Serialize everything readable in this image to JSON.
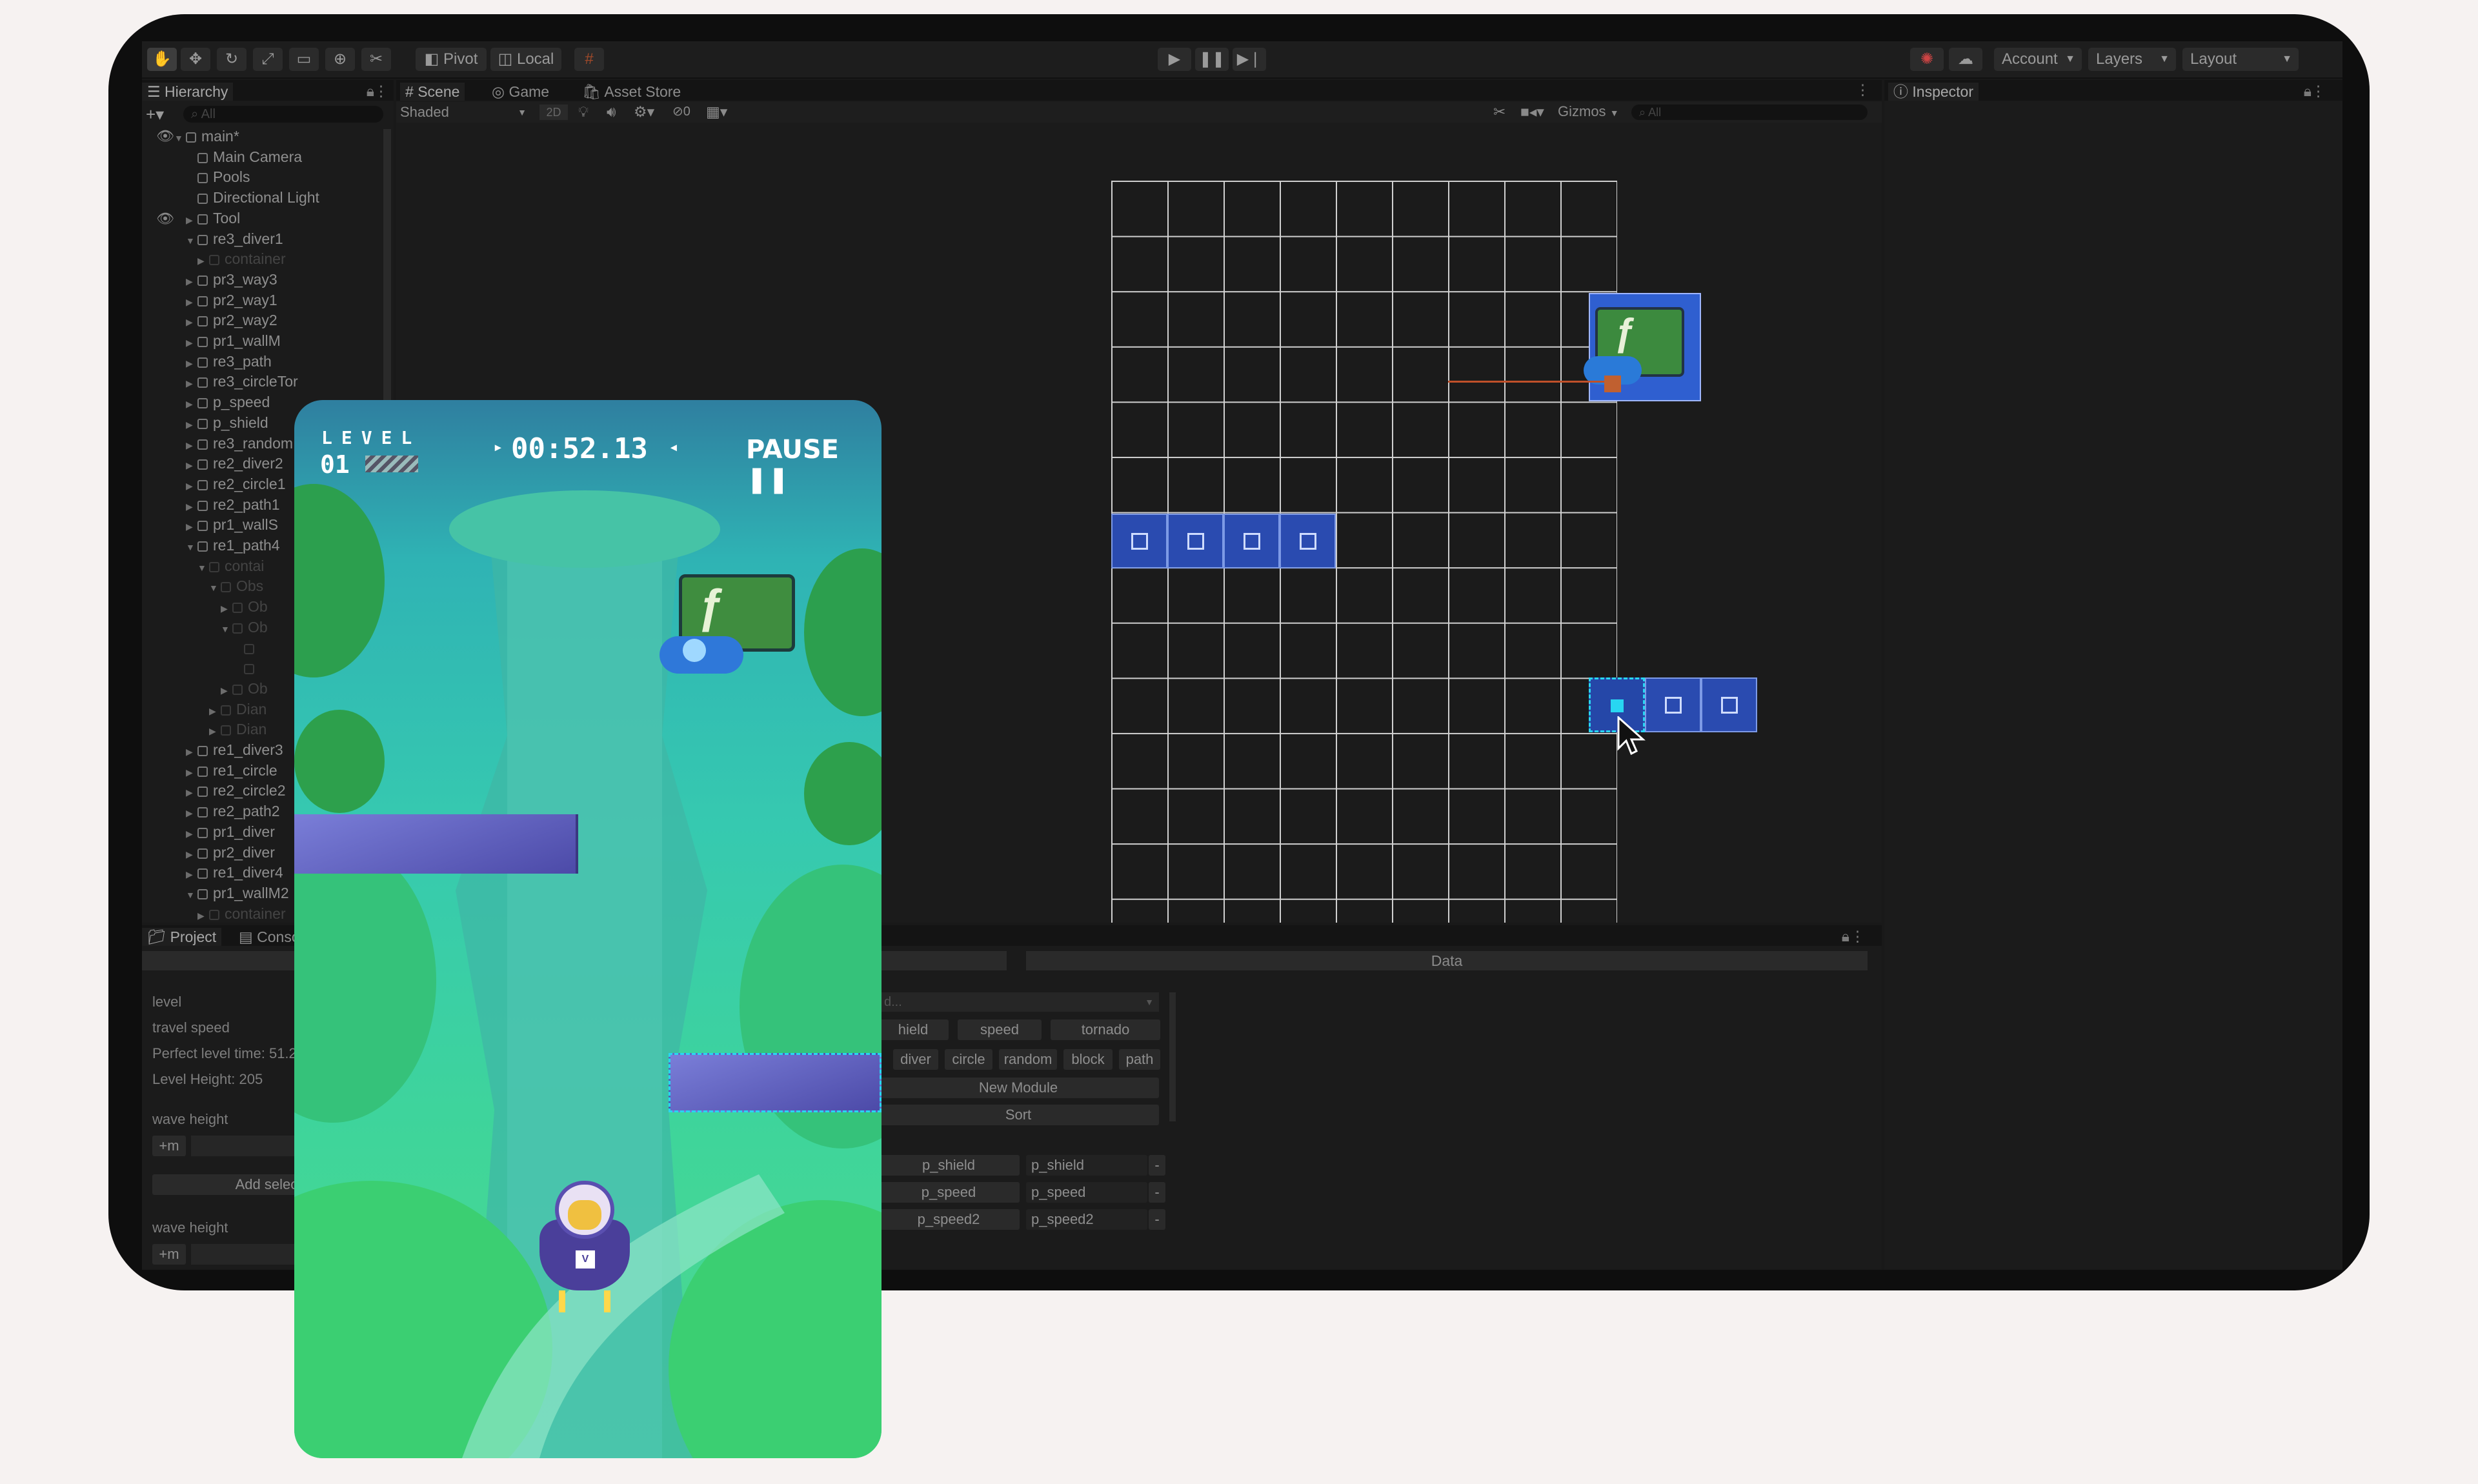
{
  "toolbar": {
    "pivot": "Pivot",
    "local": "Local",
    "account": "Account",
    "layers": "Layers",
    "layout": "Layout"
  },
  "hierarchy": {
    "tab": "Hierarchy",
    "search_placeholder": "All",
    "items": [
      {
        "label": "main*",
        "depth": 0,
        "arrow": "▼"
      },
      {
        "label": "Main Camera",
        "depth": 1,
        "arrow": ""
      },
      {
        "label": "Pools",
        "depth": 1,
        "arrow": ""
      },
      {
        "label": "Directional Light",
        "depth": 1,
        "arrow": ""
      },
      {
        "label": "Tool",
        "depth": 1,
        "arrow": "▶"
      },
      {
        "label": "re3_diver1",
        "depth": 1,
        "arrow": "▼"
      },
      {
        "label": "container",
        "depth": 2,
        "arrow": "▶",
        "dim": true
      },
      {
        "label": "pr3_way3",
        "depth": 1,
        "arrow": "▶"
      },
      {
        "label": "pr2_way1",
        "depth": 1,
        "arrow": "▶"
      },
      {
        "label": "pr2_way2",
        "depth": 1,
        "arrow": "▶"
      },
      {
        "label": "pr1_wallM",
        "depth": 1,
        "arrow": "▶"
      },
      {
        "label": "re3_path",
        "depth": 1,
        "arrow": "▶"
      },
      {
        "label": "re3_circleTor",
        "depth": 1,
        "arrow": "▶"
      },
      {
        "label": "p_speed",
        "depth": 1,
        "arrow": "▶"
      },
      {
        "label": "p_shield",
        "depth": 1,
        "arrow": "▶"
      },
      {
        "label": "re3_random",
        "depth": 1,
        "arrow": "▶"
      },
      {
        "label": "re2_diver2",
        "depth": 1,
        "arrow": "▶"
      },
      {
        "label": "re2_circle1",
        "depth": 1,
        "arrow": "▶"
      },
      {
        "label": "re2_path1",
        "depth": 1,
        "arrow": "▶"
      },
      {
        "label": "pr1_wallS",
        "depth": 1,
        "arrow": "▶"
      },
      {
        "label": "re1_path4",
        "depth": 1,
        "arrow": "▼"
      },
      {
        "label": "contai",
        "depth": 2,
        "arrow": "▼",
        "dim": true
      },
      {
        "label": "Obs",
        "depth": 3,
        "arrow": "▼",
        "dim": true
      },
      {
        "label": "Ob",
        "depth": 4,
        "arrow": "▶",
        "dim": true
      },
      {
        "label": "Ob",
        "depth": 4,
        "arrow": "▼",
        "dim": true
      },
      {
        "label": "",
        "depth": 5,
        "arrow": "",
        "dim": true
      },
      {
        "label": "",
        "depth": 5,
        "arrow": "",
        "dim": true
      },
      {
        "label": "Ob",
        "depth": 4,
        "arrow": "▶",
        "dim": true
      },
      {
        "label": "Dian",
        "depth": 3,
        "arrow": "▶",
        "dim": true
      },
      {
        "label": "Dian",
        "depth": 3,
        "arrow": "▶",
        "dim": true
      },
      {
        "label": "re1_diver3",
        "depth": 1,
        "arrow": "▶"
      },
      {
        "label": "re1_circle",
        "depth": 1,
        "arrow": "▶"
      },
      {
        "label": "re2_circle2",
        "depth": 1,
        "arrow": "▶"
      },
      {
        "label": "re2_path2",
        "depth": 1,
        "arrow": "▶"
      },
      {
        "label": "pr1_diver",
        "depth": 1,
        "arrow": "▶"
      },
      {
        "label": "pr2_diver",
        "depth": 1,
        "arrow": "▶"
      },
      {
        "label": "re1_diver4",
        "depth": 1,
        "arrow": "▶"
      },
      {
        "label": "pr1_wallM2",
        "depth": 1,
        "arrow": "▼"
      },
      {
        "label": "container",
        "depth": 2,
        "arrow": "▶",
        "dim": true
      }
    ]
  },
  "scene": {
    "tabs": [
      "Scene",
      "Game",
      "Asset Store"
    ],
    "shading": "Shaded",
    "mode_2d": "2D",
    "gizmos": "Gizmos",
    "search_placeholder": "All",
    "hidden_count": "0"
  },
  "inspector": {
    "tab": "Inspector"
  },
  "project": {
    "tabs": [
      "Project",
      "Console"
    ],
    "data_header": "Data",
    "fields": {
      "level": "level",
      "travel_speed": "travel speed",
      "perfect_time": "Perfect level time: 51.2",
      "level_height": "Level Height: 205",
      "wave_height_1": "wave height",
      "wave_height_2": "wave height",
      "add_select": "Add select",
      "plus_m_1": "+m",
      "plus_m_2": "+m"
    },
    "dropdown_value": "d...",
    "module_buttons_row1": [
      "hield",
      "speed",
      "tornado"
    ],
    "module_buttons_row2": [
      "diver",
      "circle",
      "random",
      "block",
      "path"
    ],
    "new_module": "New Module",
    "sort": "Sort",
    "list_rows": [
      {
        "name": "p_shield",
        "value": "p_shield"
      },
      {
        "name": "p_speed",
        "value": "p_speed"
      },
      {
        "name": "p_speed2",
        "value": "p_speed2"
      }
    ],
    "remove_label": "-"
  },
  "game": {
    "level_label": "LEVEL",
    "level_number": "01",
    "timer": "00:52.13",
    "pause": "PAUSE"
  },
  "colors": {
    "background": "#f6f2f1",
    "editor_bg": "#191919",
    "tile_blue": "#2a4bb0",
    "selected_cyan": "#28d6f2",
    "game_teal": "#36c9b0"
  }
}
